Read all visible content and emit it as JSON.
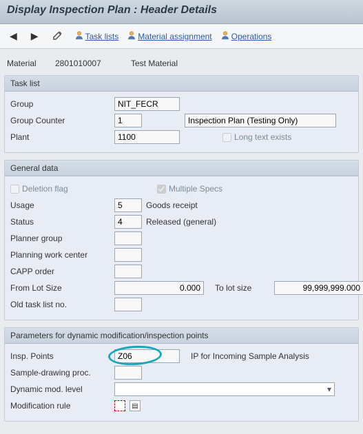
{
  "title": "Display Inspection Plan : Header Details",
  "toolbar": {
    "task_lists": "Task lists",
    "material_assignment": "Material assignment",
    "operations": "Operations"
  },
  "material": {
    "label": "Material",
    "number": "2801010007",
    "desc": "Test Material"
  },
  "task_list": {
    "title": "Task list",
    "group_label": "Group",
    "group_value": "NIT_FECR",
    "counter_label": "Group Counter",
    "counter_value": "1",
    "counter_desc": "Inspection Plan (Testing Only)",
    "plant_label": "Plant",
    "plant_value": "1100",
    "long_text_label": "Long text exists"
  },
  "general": {
    "title": "General data",
    "deletion_flag": "Deletion flag",
    "multiple_specs": "Multiple Specs",
    "usage_label": "Usage",
    "usage_value": "5",
    "usage_desc": "Goods receipt",
    "status_label": "Status",
    "status_value": "4",
    "status_desc": "Released (general)",
    "planner_group_label": "Planner group",
    "planner_group_value": "",
    "pwc_label": "Planning work center",
    "pwc_value": "",
    "capp_label": "CAPP order",
    "capp_value": "",
    "from_lot_label": "From Lot Size",
    "from_lot_value": "0.000",
    "to_lot_label": "To lot size",
    "to_lot_value": "99,999,999.000",
    "old_task_label": "Old task list no.",
    "old_task_value": ""
  },
  "params": {
    "title": "Parameters for dynamic modification/inspection points",
    "insp_points_label": "Insp. Points",
    "insp_points_value": "Z06",
    "insp_points_desc": "IP for Incoming Sample Analysis",
    "sample_proc_label": "Sample-drawing proc.",
    "sample_proc_value": "",
    "dyn_mod_label": "Dynamic mod. level",
    "mod_rule_label": "Modification rule"
  }
}
